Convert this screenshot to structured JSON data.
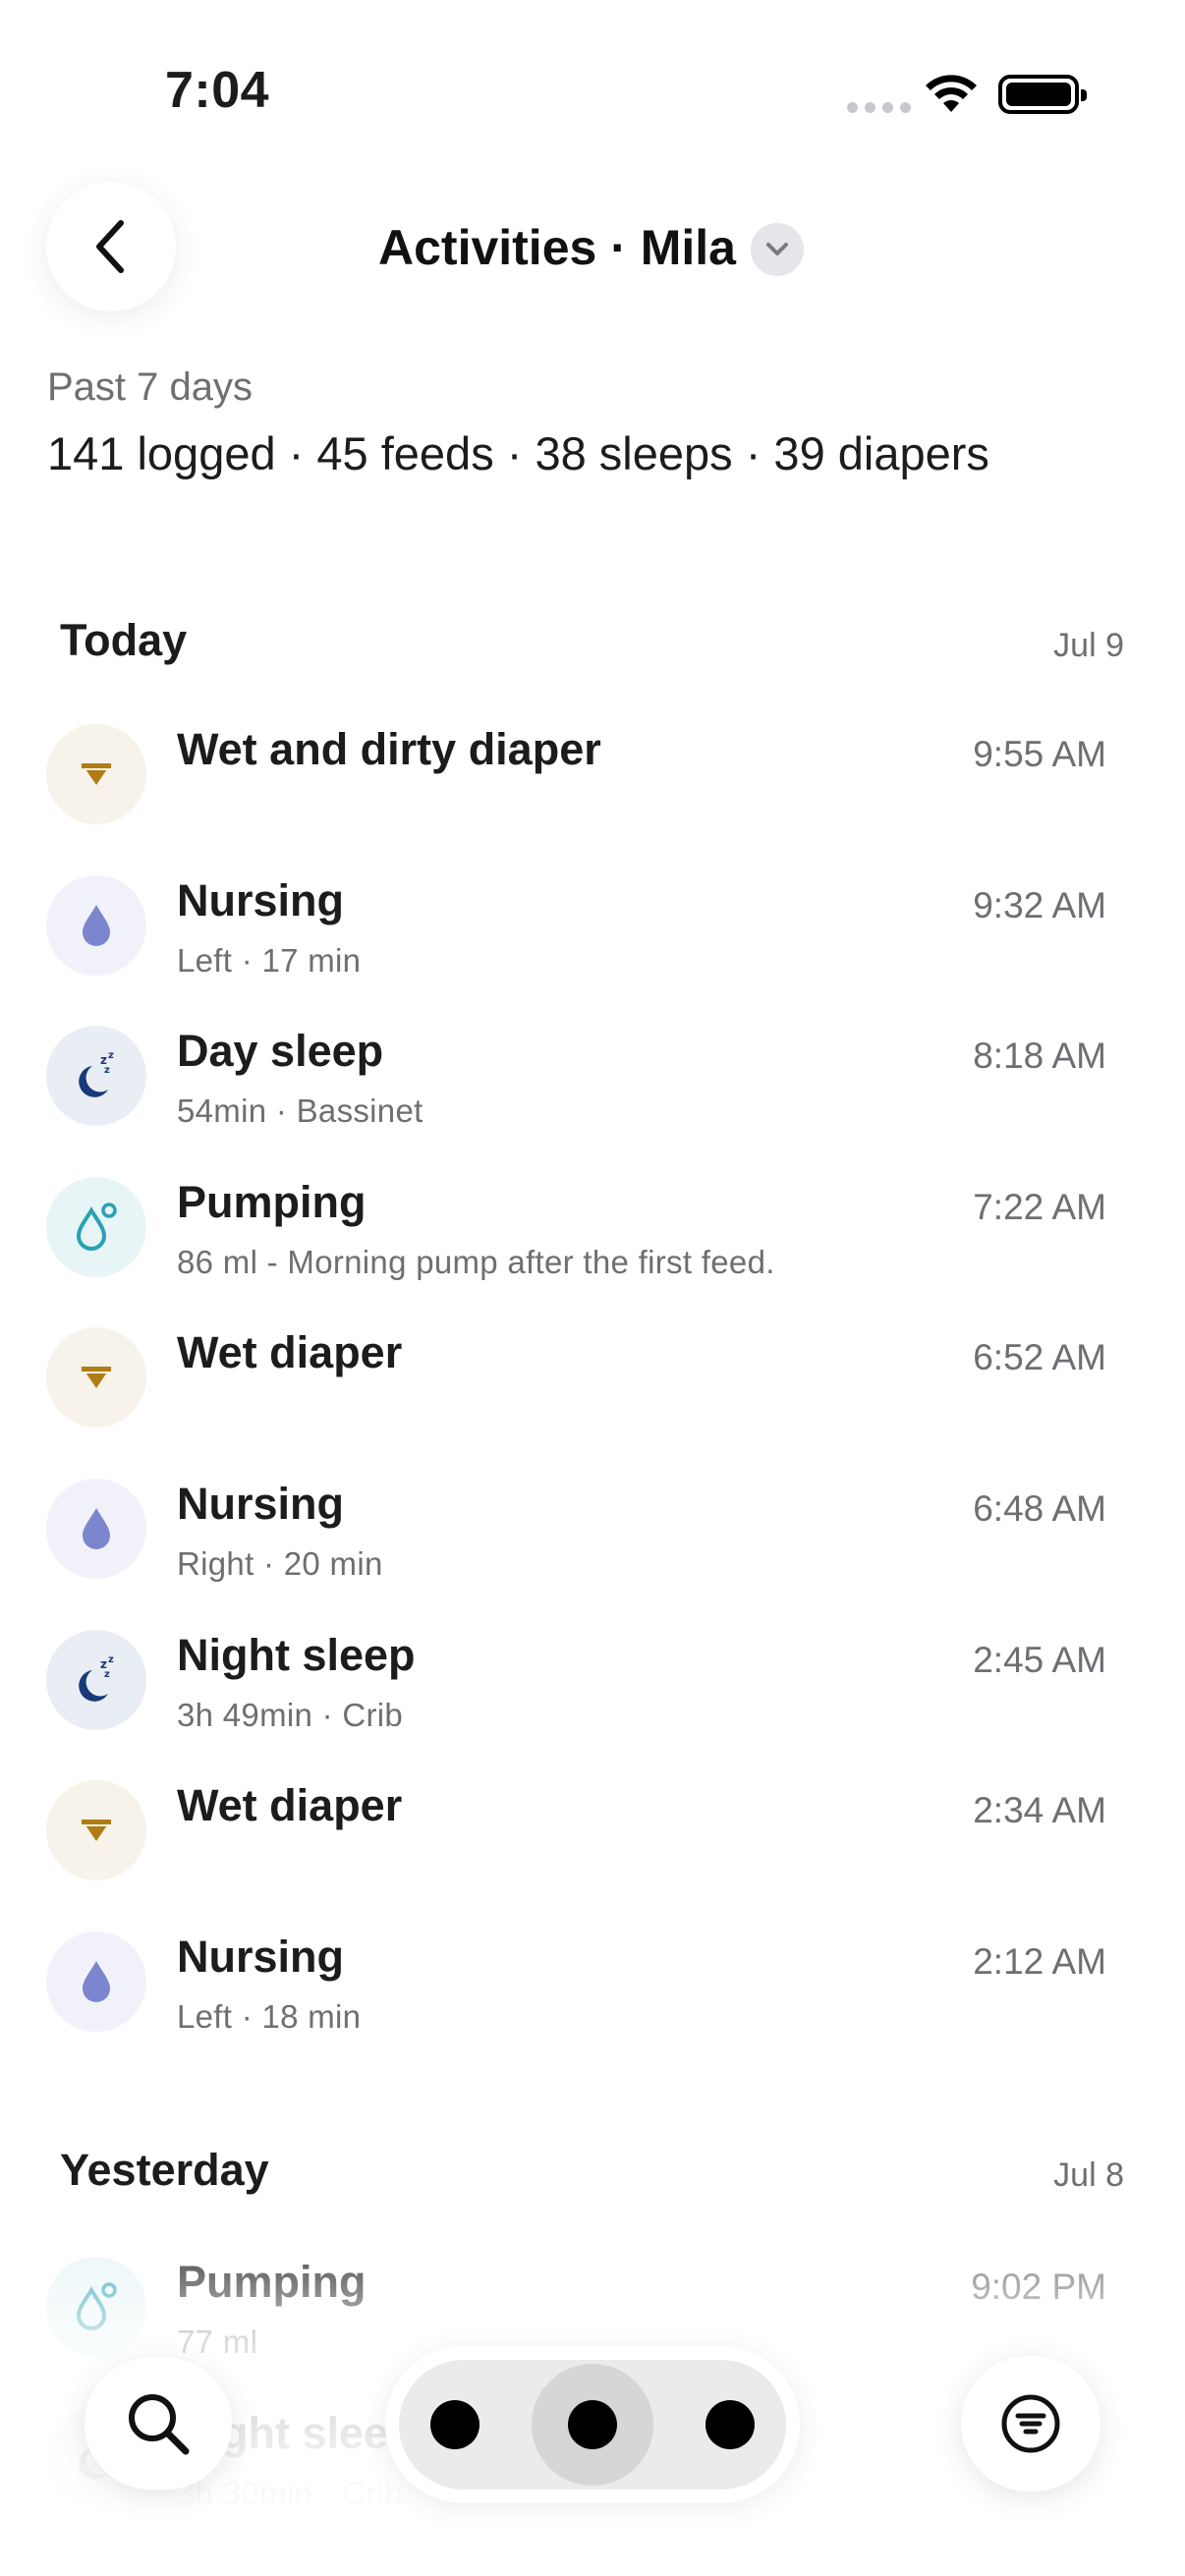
{
  "status": {
    "time": "7:04"
  },
  "header": {
    "title": "Activities · Mila",
    "dropdown_icon": "chevron-down-icon",
    "back_icon": "chevron-left-icon"
  },
  "summary": {
    "period": "Past 7 days",
    "stats": "141 logged · 45 feeds · 38 sleeps · 39 diapers"
  },
  "sections": [
    {
      "title": "Today",
      "date": "Jul 9",
      "items": [
        {
          "kind": "diaper",
          "title": "Wet and dirty diaper",
          "subtitle": "",
          "time": "9:55 AM"
        },
        {
          "kind": "nursing",
          "title": "Nursing",
          "subtitle": "Left · 17 min",
          "time": "9:32 AM"
        },
        {
          "kind": "sleep",
          "title": "Day sleep",
          "subtitle": "54min · Bassinet",
          "time": "8:18 AM"
        },
        {
          "kind": "pump",
          "title": "Pumping",
          "subtitle": "86 ml - Morning pump after the first feed.",
          "time": "7:22 AM"
        },
        {
          "kind": "diaper",
          "title": "Wet diaper",
          "subtitle": "",
          "time": "6:52 AM"
        },
        {
          "kind": "nursing",
          "title": "Nursing",
          "subtitle": "Right · 20 min",
          "time": "6:48 AM"
        },
        {
          "kind": "sleep",
          "title": "Night sleep",
          "subtitle": "3h 49min · Crib",
          "time": "2:45 AM"
        },
        {
          "kind": "diaper",
          "title": "Wet diaper",
          "subtitle": "",
          "time": "2:34 AM"
        },
        {
          "kind": "nursing",
          "title": "Nursing",
          "subtitle": "Left · 18 min",
          "time": "2:12 AM"
        }
      ]
    },
    {
      "title": "Yesterday",
      "date": "Jul 8",
      "items": [
        {
          "kind": "pump",
          "title": "Pumping",
          "subtitle": "77 ml",
          "time": "9:02 PM"
        },
        {
          "kind": "sleep",
          "title": "Night sleep",
          "subtitle": "3h 30min · Crib",
          "time": ""
        }
      ]
    }
  ],
  "bottom_bar": {
    "search_icon": "search-icon",
    "filter_icon": "filter-icon",
    "pages": 3,
    "active_page": 2
  },
  "colors": {
    "diaper_icon": "#b07d14",
    "nursing_icon": "#7c86cf",
    "sleep_icon": "#183a7a",
    "pump_icon": "#2aa1b3"
  }
}
